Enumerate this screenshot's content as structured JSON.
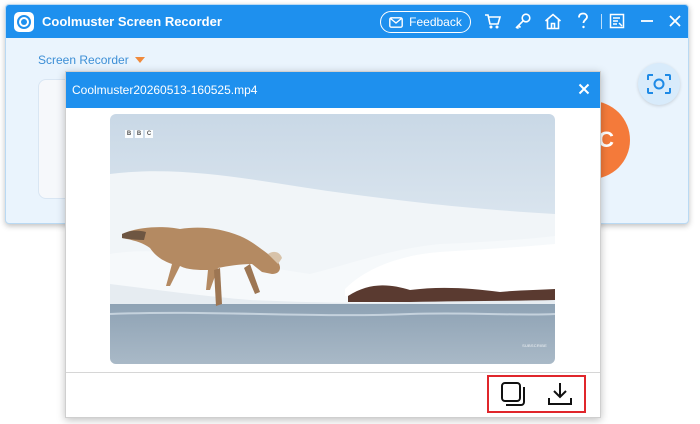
{
  "app": {
    "title": "Coolmuster Screen Recorder",
    "feedback_label": "Feedback",
    "mode_label": "Screen Recorder",
    "record_glyph": "C",
    "toolbar_icons": [
      "cart-icon",
      "key-icon",
      "home-icon",
      "help-icon",
      "register-icon",
      "minimize-icon",
      "close-icon"
    ]
  },
  "dialog": {
    "title": "Coolmuster20260513-160525.mp4",
    "video_watermark": [
      "B",
      "B",
      "C"
    ],
    "video_corner_text": "SUBSCRIBE",
    "actions": [
      "copy-icon",
      "download-icon"
    ]
  },
  "colors": {
    "brand": "#1e90ee",
    "record": "#f47a3a",
    "highlight": "#e0262b"
  }
}
